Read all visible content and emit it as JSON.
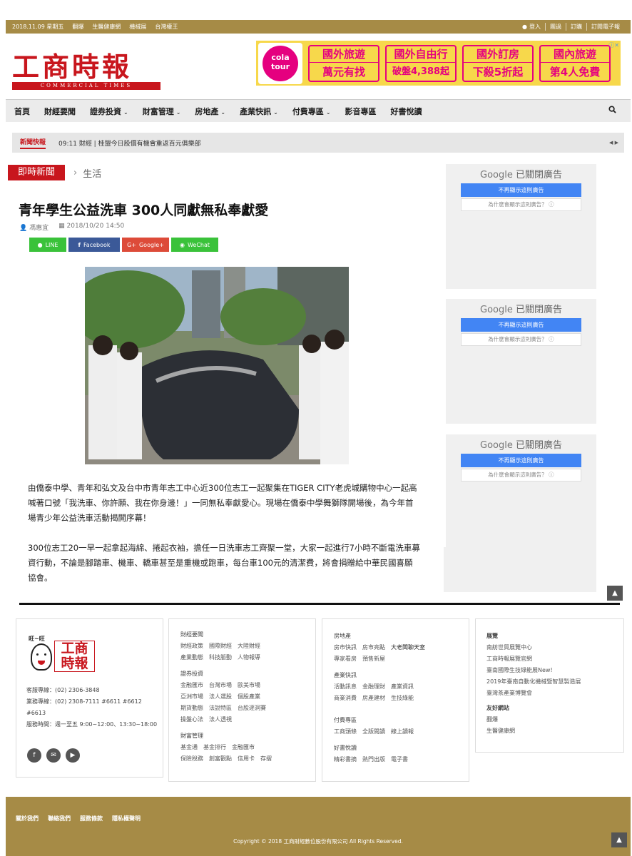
{
  "topbar": {
    "date": "2018.11.09 星期五",
    "links": [
      "翻爆",
      "生醫健康網",
      "機械展",
      "台灣權王"
    ],
    "login": "登入",
    "right_links": [
      "團過",
      "訂購",
      "訂閱電子報"
    ]
  },
  "logo": {
    "name": "工商時報",
    "sub": "COMMERCIAL TIMES"
  },
  "ad": {
    "brand_l1": "cola",
    "brand_l2": "tour",
    "cells": [
      {
        "l1": "國外旅遊",
        "l2": "萬元有找"
      },
      {
        "l1": "國外自由行",
        "l2": "破盤4,388起"
      },
      {
        "l1": "國外訂房",
        "l2": "下殺5折起"
      },
      {
        "l1": "國內旅遊",
        "l2": "第4人免費"
      }
    ]
  },
  "nav": {
    "items": [
      {
        "label": "首頁",
        "dropdown": false
      },
      {
        "label": "財經要聞",
        "dropdown": false
      },
      {
        "label": "證券投資",
        "dropdown": true
      },
      {
        "label": "財富管理",
        "dropdown": true
      },
      {
        "label": "房地產",
        "dropdown": true
      },
      {
        "label": "產業快訊",
        "dropdown": true
      },
      {
        "label": "付費專區",
        "dropdown": true
      },
      {
        "label": "影音專區",
        "dropdown": false
      },
      {
        "label": "好書悅讀",
        "dropdown": false
      }
    ]
  },
  "ticker": {
    "label": "新聞快報",
    "text": "09:11 財經 | 桂盟今日股價有機會重返百元俱樂部"
  },
  "breadcrumb": {
    "tag": "即時新聞",
    "category": "生活"
  },
  "article": {
    "title": "青年學生公益洗車 300人同獻無私奉獻愛",
    "author": "馮惠宜",
    "datetime": "2018/10/20 14:50",
    "share": [
      "LINE",
      "Facebook",
      "Google+",
      "WeChat"
    ],
    "share_colors": [
      "#3ac23a",
      "#3b5998",
      "#dd4b39",
      "#3ac23a"
    ],
    "paragraphs": [
      "由僑泰中學、青年和弘文及台中市青年志工中心近300位志工一起聚集在TIGER CITY老虎城購物中心一起高喊著口號「我洗車、你許願、我在你身邊！」一同無私奉獻愛心。現場在僑泰中學舞獅隊開場後，為今年首場青少年公益洗車活動揭開序幕！",
      "300位志工20一早一起拿起海綿、捲起衣袖，擔任一日洗車志工齊聚一堂，大家一起進行7小時不斷電洗車募資行動，不論是腳踏車、機車、轎車甚至是重機或跑車，每台車100元的清潔費，將會捐贈給中華民國喜願協會。"
    ]
  },
  "google_ad": {
    "brand": "Google",
    "closed": "已關閉廣告",
    "stop": "不再顯示這則廣告",
    "why": "為什麼會顯示這則廣告？"
  },
  "footer": {
    "contact": [
      "客服專線：(02) 2306-3848",
      "業務專線：(02) 2308-7111 #6611 #6612 #6613",
      "服務時間：週一至五 9:00~12:00、13:30~18:00"
    ],
    "logo_top": "旺~旺",
    "logo_text": "工商時報",
    "col2": [
      {
        "h": "財經要聞",
        "rows": [
          [
            "財經政策",
            "國際財經",
            "大陸財經"
          ],
          [
            "產業動態",
            "科技脈動",
            "人物報導"
          ]
        ]
      },
      {
        "h": "證券投資",
        "rows": [
          [
            "金融匯市",
            "台灣市場",
            "歐美市場"
          ],
          [
            "亞洲市場",
            "法人選股",
            "個股產業"
          ],
          [
            "期貨動態",
            "法說特區",
            "台股逐洞賽"
          ],
          [
            "操盤心法",
            "法人透視"
          ]
        ]
      },
      {
        "h": "財富管理",
        "rows": [
          [
            "基金通",
            "基金排行",
            "金融匯市"
          ],
          [
            "保險稅務",
            "創富觀點",
            "信用卡",
            "存摺"
          ]
        ]
      }
    ],
    "col3": [
      {
        "h": "房地產",
        "rows": [
          [
            "房市快訊",
            "房市亮點",
            "大老闆聊天室"
          ],
          [
            "專家看房",
            "預售新屋"
          ]
        ]
      },
      {
        "h": "產業快訊",
        "rows": [
          [
            "活動訊息",
            "金融理財",
            "產業資訊"
          ],
          [
            "商業消費",
            "房產建材",
            "生技綠能"
          ]
        ]
      },
      {
        "h": "付費專區",
        "rows": [
          [
            "工商頭條",
            "全版閱讀",
            "線上讀報"
          ]
        ]
      },
      {
        "h": "好書悅讀",
        "rows": [
          [
            "精彩書摘",
            "熱門出版",
            "電子書"
          ]
        ]
      }
    ],
    "col4": [
      {
        "h": "展覽",
        "rows": [
          [
            "南紡世貿展覽中心"
          ],
          [
            "工商時報展覽官網"
          ],
          [
            "臺南國際生技綠能展New!"
          ],
          [
            "2019年臺南自動化機械暨智慧製造展"
          ],
          [
            "臺灣茶產業博覽會"
          ]
        ]
      },
      {
        "h": "友好網站",
        "rows": [
          [
            "翻爆"
          ],
          [
            "生醫健康網"
          ]
        ]
      }
    ],
    "bottom_links": [
      "關於我們",
      "聯絡我們",
      "服務條款",
      "隱私權聲明"
    ],
    "copyright": "Copyright © 2018 工商財經數位股份有限公司 All Rights Reserved."
  }
}
